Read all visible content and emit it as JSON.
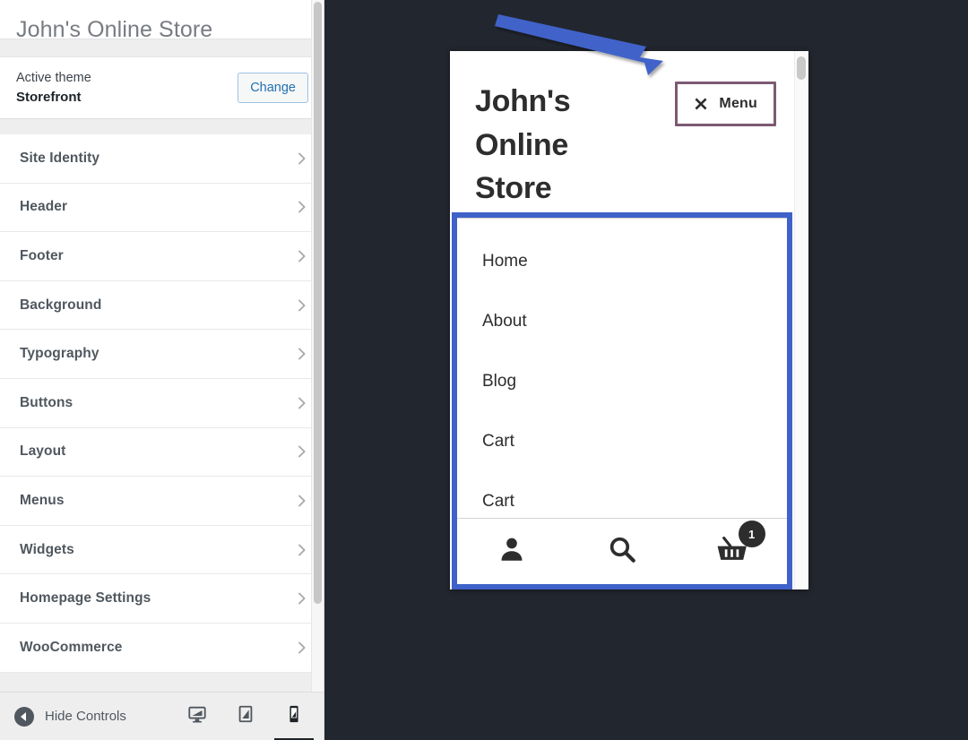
{
  "sidebar": {
    "site_title": "John's Online Store",
    "theme": {
      "label": "Active theme",
      "name": "Storefront",
      "change_label": "Change"
    },
    "panels": [
      {
        "label": "Site Identity",
        "icon": "chevron-right-icon"
      },
      {
        "label": "Header",
        "icon": "chevron-right-icon"
      },
      {
        "label": "Footer",
        "icon": "chevron-right-icon"
      },
      {
        "label": "Background",
        "icon": "chevron-right-icon"
      },
      {
        "label": "Typography",
        "icon": "chevron-right-icon"
      },
      {
        "label": "Buttons",
        "icon": "chevron-right-icon"
      },
      {
        "label": "Layout",
        "icon": "chevron-right-icon"
      },
      {
        "label": "Menus",
        "icon": "chevron-right-icon"
      },
      {
        "label": "Widgets",
        "icon": "chevron-right-icon"
      },
      {
        "label": "Homepage Settings",
        "icon": "chevron-right-icon"
      },
      {
        "label": "WooCommerce",
        "icon": "chevron-right-icon"
      }
    ],
    "footer": {
      "hide_controls_label": "Hide Controls",
      "hide_controls_icon": "collapse-left-icon",
      "devices": [
        {
          "name": "desktop",
          "icon": "desktop-icon",
          "active": false
        },
        {
          "name": "tablet",
          "icon": "tablet-icon",
          "active": false
        },
        {
          "name": "mobile",
          "icon": "mobile-icon",
          "active": true
        }
      ]
    }
  },
  "preview": {
    "store_name": "John's Online Store",
    "menu_button": {
      "label": "Menu",
      "icon": "close-x-icon",
      "border_color": "#7d5a73"
    },
    "nav_items": [
      {
        "label": "Home"
      },
      {
        "label": "About"
      },
      {
        "label": "Blog"
      },
      {
        "label": "Cart"
      },
      {
        "label": "Cart"
      }
    ],
    "toolbar": [
      {
        "name": "account",
        "icon": "person-icon"
      },
      {
        "name": "search",
        "icon": "search-icon"
      },
      {
        "name": "cart",
        "icon": "basket-icon",
        "badge": "1"
      }
    ],
    "highlight_color": "#3f62c9"
  },
  "annotation": {
    "arrow_color": "#3f62c9",
    "points_to": "Menu"
  }
}
